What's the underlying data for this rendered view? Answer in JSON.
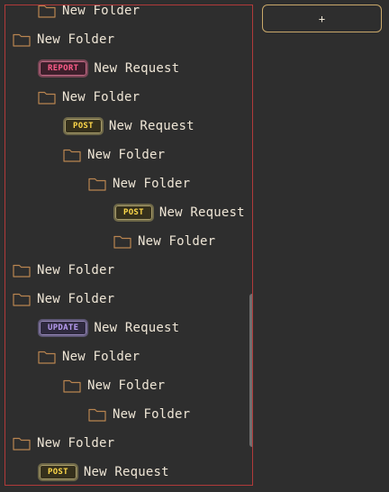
{
  "toolbar": {
    "add_label": "+"
  },
  "tree": {
    "rows": [
      {
        "kind": "folder",
        "label": "New Folder",
        "depth": 1
      },
      {
        "kind": "folder",
        "label": "New Folder",
        "depth": 0
      },
      {
        "kind": "request",
        "method": "REPORT",
        "label": "New Request",
        "depth": 1
      },
      {
        "kind": "folder",
        "label": "New Folder",
        "depth": 1
      },
      {
        "kind": "request",
        "method": "POST",
        "label": "New Request",
        "depth": 2
      },
      {
        "kind": "folder",
        "label": "New Folder",
        "depth": 2
      },
      {
        "kind": "folder",
        "label": "New Folder",
        "depth": 3
      },
      {
        "kind": "request",
        "method": "POST",
        "label": "New Request",
        "depth": 4
      },
      {
        "kind": "folder",
        "label": "New Folder",
        "depth": 4
      },
      {
        "kind": "folder",
        "label": "New Folder",
        "depth": 0
      },
      {
        "kind": "folder",
        "label": "New Folder",
        "depth": 0
      },
      {
        "kind": "request",
        "method": "UPDATE",
        "label": "New Request",
        "depth": 1
      },
      {
        "kind": "folder",
        "label": "New Folder",
        "depth": 1
      },
      {
        "kind": "folder",
        "label": "New Folder",
        "depth": 2
      },
      {
        "kind": "folder",
        "label": "New Folder",
        "depth": 3
      },
      {
        "kind": "folder",
        "label": "New Folder",
        "depth": 0
      },
      {
        "kind": "request",
        "method": "POST",
        "label": "New Request",
        "depth": 1
      }
    ]
  },
  "colors": {
    "folder_icon": "#b98550",
    "panel_border": "#b13a3a",
    "report": "#ff5c8a",
    "post": "#ffd94a",
    "update": "#b79cf0"
  },
  "icons": {
    "folder": "folder-icon"
  }
}
